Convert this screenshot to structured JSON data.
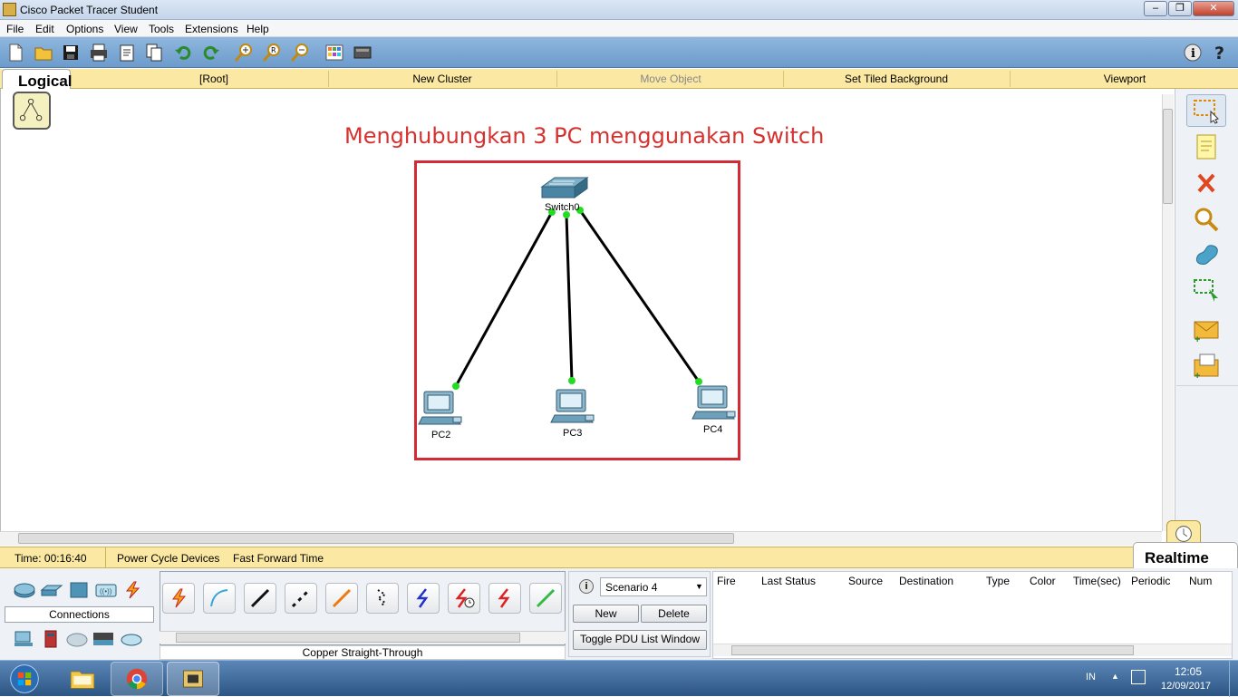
{
  "window": {
    "title": "Cisco Packet Tracer Student",
    "min": "–",
    "max": "❐",
    "close": "✕"
  },
  "menu": [
    "File",
    "Edit",
    "Options",
    "View",
    "Tools",
    "Extensions",
    "Help"
  ],
  "toolbar": {
    "icons": [
      "new-icon",
      "open-icon",
      "save-icon",
      "print-icon",
      "activity-wizard-icon",
      "copy-icon",
      "undo-icon",
      "redo-icon",
      "zoom-in-icon",
      "zoom-reset-icon",
      "zoom-out-icon",
      "palette-icon",
      "custom-device-icon"
    ],
    "help_icons": [
      "info-icon",
      "help-icon"
    ]
  },
  "workspace": {
    "logical_label": "Logical",
    "items": [
      "[Root]",
      "New Cluster",
      "Move Object",
      "Set Tiled Background",
      "Viewport"
    ],
    "disabled_item": "Move Object"
  },
  "canvas": {
    "annotation": "Menghubungkan 3 PC menggunakan Switch",
    "annotation_color": "#d5322f",
    "frame_color": "#d42a35",
    "switch_label": "Switch0",
    "pcs": [
      "PC2",
      "PC3",
      "PC4"
    ],
    "link_color": "#000000",
    "port_status_color": "#22dd22"
  },
  "right_palette": [
    "select-icon",
    "note-icon",
    "delete-icon",
    "inspect-icon",
    "draw-shape-icon",
    "resize-icon",
    "add-simple-pdu-icon",
    "add-complex-pdu-icon"
  ],
  "status": {
    "time": "Time: 00:16:40",
    "power_cycle": "Power Cycle Devices",
    "fast_forward": "Fast Forward Time",
    "mode": "Realtime"
  },
  "device_panel": {
    "category_label": "Connections",
    "selected_connection": "Copper Straight-Through",
    "connections": [
      "automatic-connection-icon",
      "console-cable-icon",
      "copper-straight-through-icon",
      "copper-cross-over-icon",
      "fiber-icon",
      "phone-cable-icon",
      "coaxial-icon",
      "serial-dce-icon",
      "serial-dte-icon",
      "octal-cable-icon"
    ]
  },
  "scenario": {
    "selected": "Scenario 4",
    "new_label": "New",
    "delete_label": "Delete",
    "toggle_label": "Toggle PDU List Window"
  },
  "pdu_table": {
    "columns": [
      "Fire",
      "Last Status",
      "Source",
      "Destination",
      "Type",
      "Color",
      "Time(sec)",
      "Periodic",
      "Num"
    ]
  },
  "taskbar": {
    "lang": "IN",
    "time": "12:05",
    "date": "12/09/2017",
    "apps": [
      "start-orb-icon",
      "explorer-icon",
      "chrome-icon",
      "packet-tracer-icon"
    ]
  }
}
